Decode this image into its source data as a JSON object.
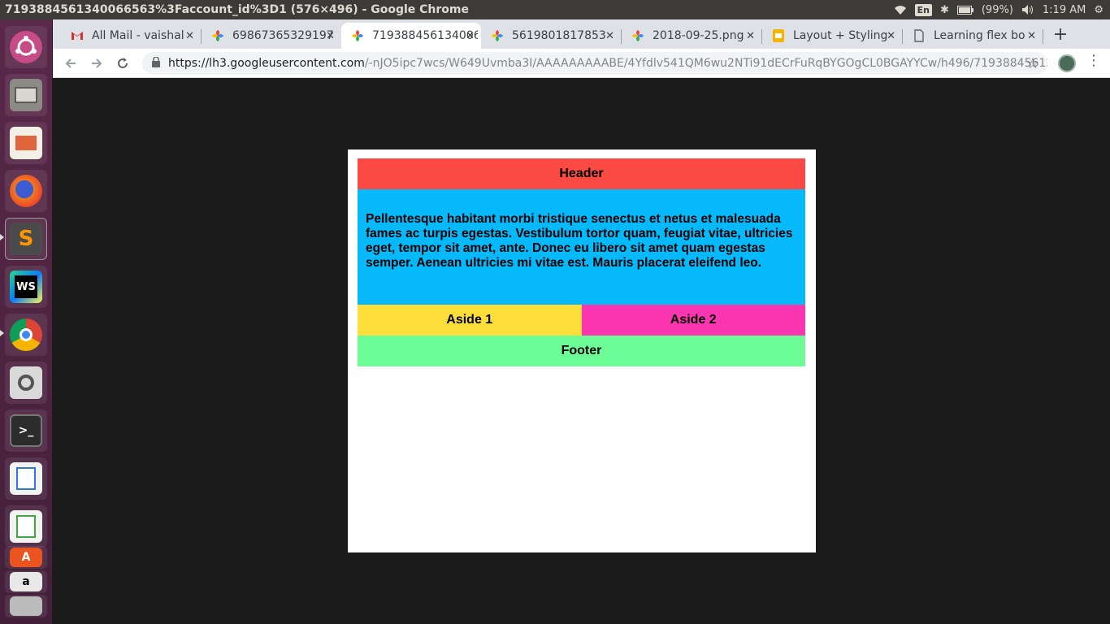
{
  "window": {
    "title": "7193884561340066563%3Faccount_id%3D1 (576×496) - Google Chrome"
  },
  "tray": {
    "lang": "En",
    "battery": "(99%)",
    "time": "1:19 AM"
  },
  "launcher": {
    "apps": [
      "ubuntu-dash",
      "files",
      "impress",
      "firefox",
      "sublime-text",
      "webstorm",
      "chrome",
      "image-viewer",
      "terminal",
      "writer",
      "calc",
      "software-center",
      "amazon"
    ]
  },
  "tabs": [
    {
      "title": "All Mail - vaishal",
      "icon": "gmail-icon"
    },
    {
      "title": "69867365329197",
      "icon": "photos-icon"
    },
    {
      "title": "7193884561340066",
      "icon": "photos-icon",
      "active": true
    },
    {
      "title": "5619801817853",
      "icon": "photos-icon"
    },
    {
      "title": "2018-09-25.png",
      "icon": "photos-icon"
    },
    {
      "title": "Layout + Styling",
      "icon": "slides-icon"
    },
    {
      "title": "Learning flex bo",
      "icon": "document-icon"
    }
  ],
  "address": {
    "host": "https://lh3.googleusercontent.com",
    "path": "/-nJO5ipc7wcs/W649Uvmba3I/AAAAAAAAABE/4Yfdlv541QM6wu2NTi91dECrFuRqBYGOgCL0BGAYYCw/h496/7193884561340..."
  },
  "demo": {
    "header": "Header",
    "main": "Pellentesque habitant morbi tristique senectus et netus et malesuada fames ac turpis egestas. Vestibulum tortor quam, feugiat vitae, ultricies eget, tempor sit amet, ante. Donec eu libero sit amet quam egestas semper. Aenean ultricies mi vitae est. Mauris placerat eleifend leo.",
    "aside1": "Aside 1",
    "aside2": "Aside 2",
    "footer": "Footer"
  },
  "colors": {
    "header": "#fb4a44",
    "main": "#05b9fb",
    "aside1": "#fcdd3a",
    "aside2": "#fc35b0",
    "footer": "#6dfd97"
  }
}
